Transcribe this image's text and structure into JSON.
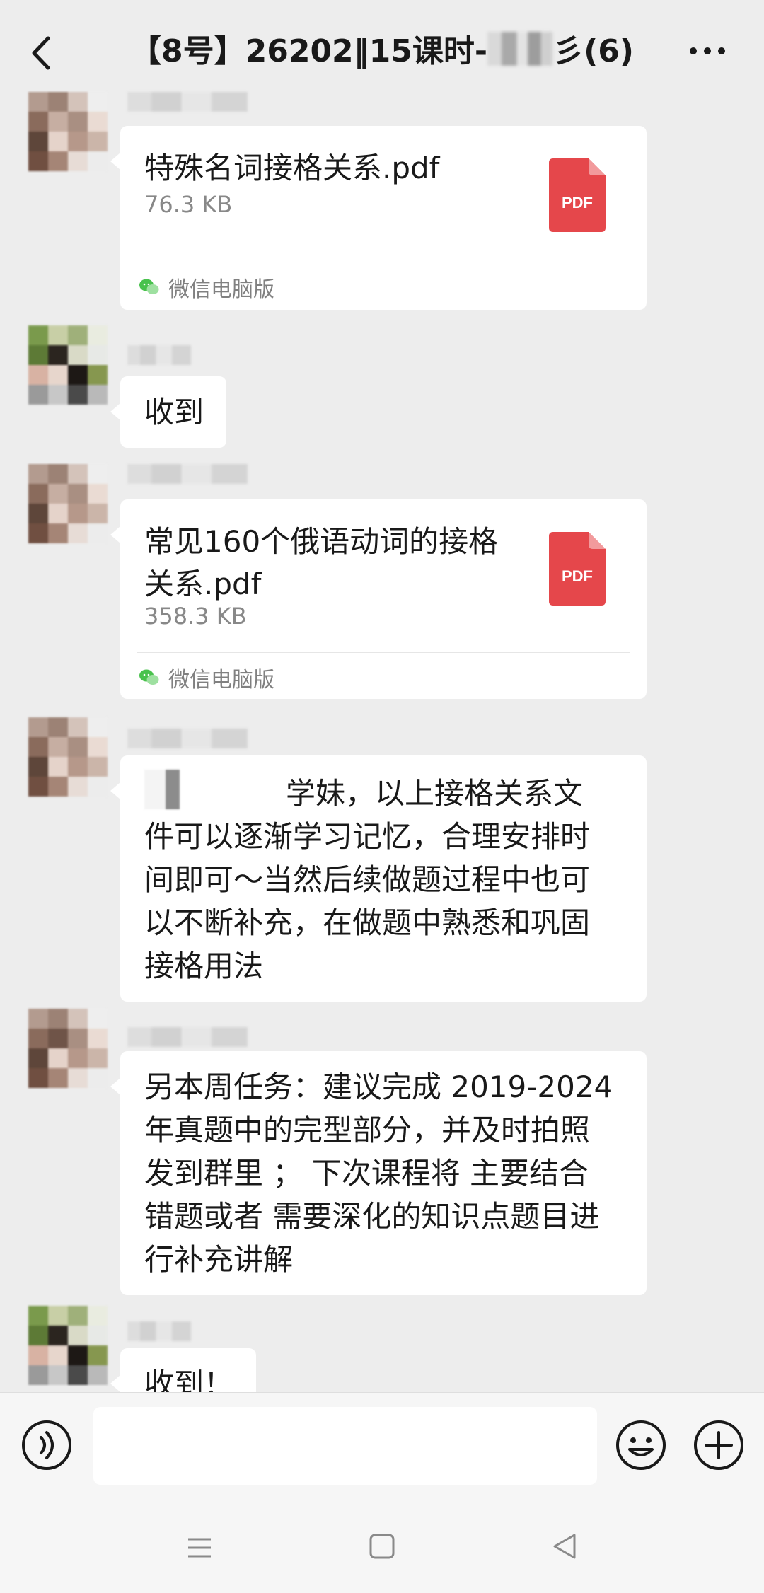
{
  "header": {
    "title_prefix": "【8号】26202‖15课时-",
    "title_suffix": "彡(6)",
    "back_icon": "chevron-left-icon",
    "more_icon": "more-dots-icon"
  },
  "messages": [
    {
      "type": "file",
      "file_name": "特殊名词接格关系.pdf",
      "file_size": "76.3 KB",
      "file_icon_label": "PDF",
      "source": "微信电脑版"
    },
    {
      "type": "text",
      "text": "收到"
    },
    {
      "type": "file",
      "file_name": "常见160个俄语动词的接格关系.pdf",
      "file_size": "358.3 KB",
      "file_icon_label": "PDF",
      "source": "微信电脑版"
    },
    {
      "type": "text",
      "lines": [
        "学妹，以上接格关系文",
        "件可以逐渐学习记忆，合理安排时",
        "间即可～当然后续做题过程中也可",
        "以不断补充，在做题中熟悉和巩固",
        "接格用法"
      ]
    },
    {
      "type": "text",
      "lines": [
        "另本周任务：建议完成 2019-2024",
        "年真题中的完型部分，并及时拍照",
        "发到群里 ； 下次课程将 主要结合",
        "错题或者 需要深化的知识点题目进",
        "行补充讲解"
      ]
    },
    {
      "type": "text",
      "text": "收到！"
    }
  ],
  "input_bar": {
    "voice_icon": "voice-icon",
    "emoji_icon": "emoji-icon",
    "plus_icon": "plus-icon"
  },
  "system_nav": {
    "menu_icon": "menu-icon",
    "home_icon": "home-square-icon",
    "back_icon": "back-triangle-icon"
  }
}
